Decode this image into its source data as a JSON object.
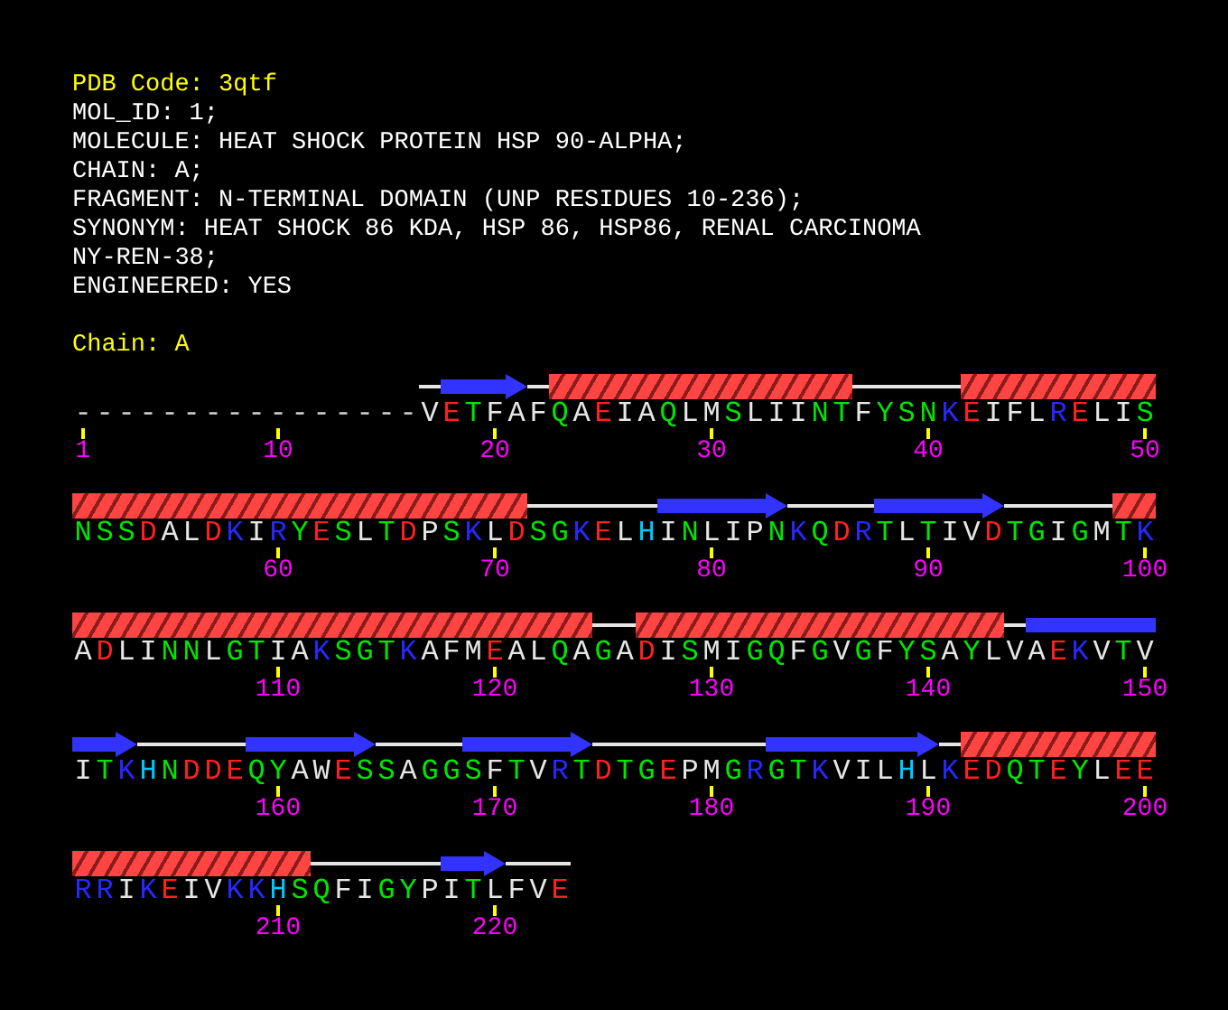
{
  "pdb_code_line": "PDB Code: 3qtf",
  "header_lines": [
    "MOL_ID: 1;",
    "MOLECULE: HEAT SHOCK PROTEIN HSP 90-ALPHA;",
    "CHAIN: A;",
    "FRAGMENT: N-TERMINAL DOMAIN (UNP RESIDUES 10-236);",
    "SYNONYM: HEAT SHOCK 86 KDA, HSP 86, HSP86, RENAL CARCINOMA",
    "NY-REN-38;",
    "ENGINEERED: YES"
  ],
  "chain_line": "Chain: A",
  "rows": [
    {
      "residues": [
        {
          "aa": "-",
          "color": "#d0d0d0",
          "kind": "gap",
          "label": "1"
        },
        {
          "aa": "-",
          "color": "#d0d0d0",
          "kind": "gap"
        },
        {
          "aa": "-",
          "color": "#d0d0d0",
          "kind": "gap"
        },
        {
          "aa": "-",
          "color": "#d0d0d0",
          "kind": "gap"
        },
        {
          "aa": "-",
          "color": "#d0d0d0",
          "kind": "gap"
        },
        {
          "aa": "-",
          "color": "#d0d0d0",
          "kind": "gap"
        },
        {
          "aa": "-",
          "color": "#d0d0d0",
          "kind": "gap"
        },
        {
          "aa": "-",
          "color": "#d0d0d0",
          "kind": "gap"
        },
        {
          "aa": "-",
          "color": "#d0d0d0",
          "kind": "gap"
        },
        {
          "aa": "-",
          "color": "#d0d0d0",
          "kind": "gap",
          "label": "10"
        },
        {
          "aa": "-",
          "color": "#d0d0d0",
          "kind": "gap"
        },
        {
          "aa": "-",
          "color": "#d0d0d0",
          "kind": "gap"
        },
        {
          "aa": "-",
          "color": "#d0d0d0",
          "kind": "gap"
        },
        {
          "aa": "-",
          "color": "#d0d0d0",
          "kind": "gap"
        },
        {
          "aa": "-",
          "color": "#d0d0d0",
          "kind": "gap"
        },
        {
          "aa": "-",
          "color": "#d0d0d0",
          "kind": "gap"
        },
        {
          "aa": "V",
          "color": "#e6e6e6",
          "kind": "coil"
        },
        {
          "aa": "E",
          "color": "#ff2020",
          "kind": "strand"
        },
        {
          "aa": "T",
          "color": "#00e600",
          "kind": "strand"
        },
        {
          "aa": "F",
          "color": "#e6e6e6",
          "kind": "strand",
          "label": "20"
        },
        {
          "aa": "A",
          "color": "#e6e6e6",
          "kind": "strand"
        },
        {
          "aa": "F",
          "color": "#e6e6e6",
          "kind": "coil"
        },
        {
          "aa": "Q",
          "color": "#00e600",
          "kind": "helix"
        },
        {
          "aa": "A",
          "color": "#e6e6e6",
          "kind": "helix"
        },
        {
          "aa": "E",
          "color": "#ff2020",
          "kind": "helix"
        },
        {
          "aa": "I",
          "color": "#e6e6e6",
          "kind": "helix"
        },
        {
          "aa": "A",
          "color": "#e6e6e6",
          "kind": "helix"
        },
        {
          "aa": "Q",
          "color": "#00e600",
          "kind": "helix"
        },
        {
          "aa": "L",
          "color": "#e6e6e6",
          "kind": "helix"
        },
        {
          "aa": "M",
          "color": "#e6e6e6",
          "kind": "helix",
          "label": "30"
        },
        {
          "aa": "S",
          "color": "#00e600",
          "kind": "helix"
        },
        {
          "aa": "L",
          "color": "#e6e6e6",
          "kind": "helix"
        },
        {
          "aa": "I",
          "color": "#e6e6e6",
          "kind": "helix"
        },
        {
          "aa": "I",
          "color": "#e6e6e6",
          "kind": "helix"
        },
        {
          "aa": "N",
          "color": "#00e600",
          "kind": "helix"
        },
        {
          "aa": "T",
          "color": "#00e600",
          "kind": "helix"
        },
        {
          "aa": "F",
          "color": "#e6e6e6",
          "kind": "coil"
        },
        {
          "aa": "Y",
          "color": "#00e600",
          "kind": "coil"
        },
        {
          "aa": "S",
          "color": "#00e600",
          "kind": "coil"
        },
        {
          "aa": "N",
          "color": "#00e600",
          "kind": "coil",
          "label": "40"
        },
        {
          "aa": "K",
          "color": "#2828ff",
          "kind": "coil"
        },
        {
          "aa": "E",
          "color": "#ff2020",
          "kind": "helix"
        },
        {
          "aa": "I",
          "color": "#e6e6e6",
          "kind": "helix"
        },
        {
          "aa": "F",
          "color": "#e6e6e6",
          "kind": "helix"
        },
        {
          "aa": "L",
          "color": "#e6e6e6",
          "kind": "helix"
        },
        {
          "aa": "R",
          "color": "#2828ff",
          "kind": "helix"
        },
        {
          "aa": "E",
          "color": "#ff2020",
          "kind": "helix"
        },
        {
          "aa": "L",
          "color": "#e6e6e6",
          "kind": "helix"
        },
        {
          "aa": "I",
          "color": "#e6e6e6",
          "kind": "helix"
        },
        {
          "aa": "S",
          "color": "#00e600",
          "kind": "helix",
          "label": "50"
        }
      ]
    },
    {
      "residues": [
        {
          "aa": "N",
          "color": "#00e600",
          "kind": "helix"
        },
        {
          "aa": "S",
          "color": "#00e600",
          "kind": "helix"
        },
        {
          "aa": "S",
          "color": "#00e600",
          "kind": "helix"
        },
        {
          "aa": "D",
          "color": "#ff2020",
          "kind": "helix"
        },
        {
          "aa": "A",
          "color": "#e6e6e6",
          "kind": "helix"
        },
        {
          "aa": "L",
          "color": "#e6e6e6",
          "kind": "helix"
        },
        {
          "aa": "D",
          "color": "#ff2020",
          "kind": "helix"
        },
        {
          "aa": "K",
          "color": "#2828ff",
          "kind": "helix"
        },
        {
          "aa": "I",
          "color": "#e6e6e6",
          "kind": "helix"
        },
        {
          "aa": "R",
          "color": "#2828ff",
          "kind": "helix",
          "label": "60"
        },
        {
          "aa": "Y",
          "color": "#00e600",
          "kind": "helix"
        },
        {
          "aa": "E",
          "color": "#ff2020",
          "kind": "helix"
        },
        {
          "aa": "S",
          "color": "#00e600",
          "kind": "helix"
        },
        {
          "aa": "L",
          "color": "#e6e6e6",
          "kind": "helix"
        },
        {
          "aa": "T",
          "color": "#00e600",
          "kind": "helix"
        },
        {
          "aa": "D",
          "color": "#ff2020",
          "kind": "helix"
        },
        {
          "aa": "P",
          "color": "#e6e6e6",
          "kind": "helix"
        },
        {
          "aa": "S",
          "color": "#00e600",
          "kind": "helix"
        },
        {
          "aa": "K",
          "color": "#2828ff",
          "kind": "helix"
        },
        {
          "aa": "L",
          "color": "#e6e6e6",
          "kind": "helix",
          "label": "70"
        },
        {
          "aa": "D",
          "color": "#ff2020",
          "kind": "helix"
        },
        {
          "aa": "S",
          "color": "#00e600",
          "kind": "coil"
        },
        {
          "aa": "G",
          "color": "#00e600",
          "kind": "coil"
        },
        {
          "aa": "K",
          "color": "#2828ff",
          "kind": "coil"
        },
        {
          "aa": "E",
          "color": "#ff2020",
          "kind": "coil"
        },
        {
          "aa": "L",
          "color": "#e6e6e6",
          "kind": "coil"
        },
        {
          "aa": "H",
          "color": "#00c8ff",
          "kind": "coil"
        },
        {
          "aa": "I",
          "color": "#e6e6e6",
          "kind": "strand"
        },
        {
          "aa": "N",
          "color": "#00e600",
          "kind": "strand"
        },
        {
          "aa": "L",
          "color": "#e6e6e6",
          "kind": "strand",
          "label": "80"
        },
        {
          "aa": "I",
          "color": "#e6e6e6",
          "kind": "strand"
        },
        {
          "aa": "P",
          "color": "#e6e6e6",
          "kind": "strand"
        },
        {
          "aa": "N",
          "color": "#00e600",
          "kind": "strand"
        },
        {
          "aa": "K",
          "color": "#2828ff",
          "kind": "coil"
        },
        {
          "aa": "Q",
          "color": "#00e600",
          "kind": "coil"
        },
        {
          "aa": "D",
          "color": "#ff2020",
          "kind": "coil"
        },
        {
          "aa": "R",
          "color": "#2828ff",
          "kind": "coil"
        },
        {
          "aa": "T",
          "color": "#00e600",
          "kind": "strand"
        },
        {
          "aa": "L",
          "color": "#e6e6e6",
          "kind": "strand"
        },
        {
          "aa": "T",
          "color": "#00e600",
          "kind": "strand",
          "label": "90"
        },
        {
          "aa": "I",
          "color": "#e6e6e6",
          "kind": "strand"
        },
        {
          "aa": "V",
          "color": "#e6e6e6",
          "kind": "strand"
        },
        {
          "aa": "D",
          "color": "#ff2020",
          "kind": "strand"
        },
        {
          "aa": "T",
          "color": "#00e600",
          "kind": "coil"
        },
        {
          "aa": "G",
          "color": "#00e600",
          "kind": "coil"
        },
        {
          "aa": "I",
          "color": "#e6e6e6",
          "kind": "coil"
        },
        {
          "aa": "G",
          "color": "#00e600",
          "kind": "coil"
        },
        {
          "aa": "M",
          "color": "#e6e6e6",
          "kind": "coil"
        },
        {
          "aa": "T",
          "color": "#00e600",
          "kind": "helix"
        },
        {
          "aa": "K",
          "color": "#2828ff",
          "kind": "helix",
          "label": "100"
        }
      ]
    },
    {
      "residues": [
        {
          "aa": "A",
          "color": "#e6e6e6",
          "kind": "helix"
        },
        {
          "aa": "D",
          "color": "#ff2020",
          "kind": "helix"
        },
        {
          "aa": "L",
          "color": "#e6e6e6",
          "kind": "helix"
        },
        {
          "aa": "I",
          "color": "#e6e6e6",
          "kind": "helix"
        },
        {
          "aa": "N",
          "color": "#00e600",
          "kind": "helix"
        },
        {
          "aa": "N",
          "color": "#00e600",
          "kind": "helix"
        },
        {
          "aa": "L",
          "color": "#e6e6e6",
          "kind": "helix"
        },
        {
          "aa": "G",
          "color": "#00e600",
          "kind": "helix"
        },
        {
          "aa": "T",
          "color": "#00e600",
          "kind": "helix"
        },
        {
          "aa": "I",
          "color": "#e6e6e6",
          "kind": "helix",
          "label": "110"
        },
        {
          "aa": "A",
          "color": "#e6e6e6",
          "kind": "helix"
        },
        {
          "aa": "K",
          "color": "#2828ff",
          "kind": "helix"
        },
        {
          "aa": "S",
          "color": "#00e600",
          "kind": "helix"
        },
        {
          "aa": "G",
          "color": "#00e600",
          "kind": "helix"
        },
        {
          "aa": "T",
          "color": "#00e600",
          "kind": "helix"
        },
        {
          "aa": "K",
          "color": "#2828ff",
          "kind": "helix"
        },
        {
          "aa": "A",
          "color": "#e6e6e6",
          "kind": "helix"
        },
        {
          "aa": "F",
          "color": "#e6e6e6",
          "kind": "helix"
        },
        {
          "aa": "M",
          "color": "#e6e6e6",
          "kind": "helix"
        },
        {
          "aa": "E",
          "color": "#ff2020",
          "kind": "helix",
          "label": "120"
        },
        {
          "aa": "A",
          "color": "#e6e6e6",
          "kind": "helix"
        },
        {
          "aa": "L",
          "color": "#e6e6e6",
          "kind": "helix"
        },
        {
          "aa": "Q",
          "color": "#00e600",
          "kind": "helix"
        },
        {
          "aa": "A",
          "color": "#e6e6e6",
          "kind": "helix"
        },
        {
          "aa": "G",
          "color": "#00e600",
          "kind": "coil"
        },
        {
          "aa": "A",
          "color": "#e6e6e6",
          "kind": "coil"
        },
        {
          "aa": "D",
          "color": "#ff2020",
          "kind": "helix"
        },
        {
          "aa": "I",
          "color": "#e6e6e6",
          "kind": "helix"
        },
        {
          "aa": "S",
          "color": "#00e600",
          "kind": "helix"
        },
        {
          "aa": "M",
          "color": "#e6e6e6",
          "kind": "helix",
          "label": "130"
        },
        {
          "aa": "I",
          "color": "#e6e6e6",
          "kind": "helix"
        },
        {
          "aa": "G",
          "color": "#00e600",
          "kind": "helix"
        },
        {
          "aa": "Q",
          "color": "#00e600",
          "kind": "helix"
        },
        {
          "aa": "F",
          "color": "#e6e6e6",
          "kind": "helix"
        },
        {
          "aa": "G",
          "color": "#00e600",
          "kind": "helix"
        },
        {
          "aa": "V",
          "color": "#e6e6e6",
          "kind": "helix"
        },
        {
          "aa": "G",
          "color": "#00e600",
          "kind": "helix"
        },
        {
          "aa": "F",
          "color": "#e6e6e6",
          "kind": "helix"
        },
        {
          "aa": "Y",
          "color": "#00e600",
          "kind": "helix"
        },
        {
          "aa": "S",
          "color": "#00e600",
          "kind": "helix",
          "label": "140"
        },
        {
          "aa": "A",
          "color": "#e6e6e6",
          "kind": "helix"
        },
        {
          "aa": "Y",
          "color": "#00e600",
          "kind": "helix"
        },
        {
          "aa": "L",
          "color": "#e6e6e6",
          "kind": "helix"
        },
        {
          "aa": "V",
          "color": "#e6e6e6",
          "kind": "coil"
        },
        {
          "aa": "A",
          "color": "#e6e6e6",
          "kind": "strand"
        },
        {
          "aa": "E",
          "color": "#ff2020",
          "kind": "strand"
        },
        {
          "aa": "K",
          "color": "#2828ff",
          "kind": "strand"
        },
        {
          "aa": "V",
          "color": "#e6e6e6",
          "kind": "strand"
        },
        {
          "aa": "T",
          "color": "#00e600",
          "kind": "strand"
        },
        {
          "aa": "V",
          "color": "#e6e6e6",
          "kind": "strand",
          "label": "150"
        }
      ]
    },
    {
      "residues": [
        {
          "aa": "I",
          "color": "#e6e6e6",
          "kind": "strand"
        },
        {
          "aa": "T",
          "color": "#00e600",
          "kind": "strand"
        },
        {
          "aa": "K",
          "color": "#2828ff",
          "kind": "strand"
        },
        {
          "aa": "H",
          "color": "#00c8ff",
          "kind": "coil"
        },
        {
          "aa": "N",
          "color": "#00e600",
          "kind": "coil"
        },
        {
          "aa": "D",
          "color": "#ff2020",
          "kind": "coil"
        },
        {
          "aa": "D",
          "color": "#ff2020",
          "kind": "coil"
        },
        {
          "aa": "E",
          "color": "#ff2020",
          "kind": "coil"
        },
        {
          "aa": "Q",
          "color": "#00e600",
          "kind": "strand"
        },
        {
          "aa": "Y",
          "color": "#00e600",
          "kind": "strand",
          "label": "160"
        },
        {
          "aa": "A",
          "color": "#e6e6e6",
          "kind": "strand"
        },
        {
          "aa": "W",
          "color": "#e6e6e6",
          "kind": "strand"
        },
        {
          "aa": "E",
          "color": "#ff2020",
          "kind": "strand"
        },
        {
          "aa": "S",
          "color": "#00e600",
          "kind": "strand"
        },
        {
          "aa": "S",
          "color": "#00e600",
          "kind": "coil"
        },
        {
          "aa": "A",
          "color": "#e6e6e6",
          "kind": "coil"
        },
        {
          "aa": "G",
          "color": "#00e600",
          "kind": "coil"
        },
        {
          "aa": "G",
          "color": "#00e600",
          "kind": "coil"
        },
        {
          "aa": "S",
          "color": "#00e600",
          "kind": "strand"
        },
        {
          "aa": "F",
          "color": "#e6e6e6",
          "kind": "strand",
          "label": "170"
        },
        {
          "aa": "T",
          "color": "#00e600",
          "kind": "strand"
        },
        {
          "aa": "V",
          "color": "#e6e6e6",
          "kind": "strand"
        },
        {
          "aa": "R",
          "color": "#2828ff",
          "kind": "strand"
        },
        {
          "aa": "T",
          "color": "#00e600",
          "kind": "strand"
        },
        {
          "aa": "D",
          "color": "#ff2020",
          "kind": "coil"
        },
        {
          "aa": "T",
          "color": "#00e600",
          "kind": "coil"
        },
        {
          "aa": "G",
          "color": "#00e600",
          "kind": "coil"
        },
        {
          "aa": "E",
          "color": "#ff2020",
          "kind": "coil"
        },
        {
          "aa": "P",
          "color": "#e6e6e6",
          "kind": "coil"
        },
        {
          "aa": "M",
          "color": "#e6e6e6",
          "kind": "coil",
          "label": "180"
        },
        {
          "aa": "G",
          "color": "#00e600",
          "kind": "coil"
        },
        {
          "aa": "R",
          "color": "#2828ff",
          "kind": "coil"
        },
        {
          "aa": "G",
          "color": "#00e600",
          "kind": "strand"
        },
        {
          "aa": "T",
          "color": "#00e600",
          "kind": "strand"
        },
        {
          "aa": "K",
          "color": "#2828ff",
          "kind": "strand"
        },
        {
          "aa": "V",
          "color": "#e6e6e6",
          "kind": "strand"
        },
        {
          "aa": "I",
          "color": "#e6e6e6",
          "kind": "strand"
        },
        {
          "aa": "L",
          "color": "#e6e6e6",
          "kind": "strand"
        },
        {
          "aa": "H",
          "color": "#00c8ff",
          "kind": "strand"
        },
        {
          "aa": "L",
          "color": "#e6e6e6",
          "kind": "strand",
          "label": "190"
        },
        {
          "aa": "K",
          "color": "#2828ff",
          "kind": "coil"
        },
        {
          "aa": "E",
          "color": "#ff2020",
          "kind": "helix"
        },
        {
          "aa": "D",
          "color": "#ff2020",
          "kind": "helix"
        },
        {
          "aa": "Q",
          "color": "#00e600",
          "kind": "helix"
        },
        {
          "aa": "T",
          "color": "#00e600",
          "kind": "helix"
        },
        {
          "aa": "E",
          "color": "#ff2020",
          "kind": "helix"
        },
        {
          "aa": "Y",
          "color": "#00e600",
          "kind": "helix"
        },
        {
          "aa": "L",
          "color": "#e6e6e6",
          "kind": "helix"
        },
        {
          "aa": "E",
          "color": "#ff2020",
          "kind": "helix"
        },
        {
          "aa": "E",
          "color": "#ff2020",
          "kind": "helix",
          "label": "200"
        }
      ]
    },
    {
      "residues": [
        {
          "aa": "R",
          "color": "#2828ff",
          "kind": "helix"
        },
        {
          "aa": "R",
          "color": "#2828ff",
          "kind": "helix"
        },
        {
          "aa": "I",
          "color": "#e6e6e6",
          "kind": "helix"
        },
        {
          "aa": "K",
          "color": "#2828ff",
          "kind": "helix"
        },
        {
          "aa": "E",
          "color": "#ff2020",
          "kind": "helix"
        },
        {
          "aa": "I",
          "color": "#e6e6e6",
          "kind": "helix"
        },
        {
          "aa": "V",
          "color": "#e6e6e6",
          "kind": "helix"
        },
        {
          "aa": "K",
          "color": "#2828ff",
          "kind": "helix"
        },
        {
          "aa": "K",
          "color": "#2828ff",
          "kind": "helix"
        },
        {
          "aa": "H",
          "color": "#00c8ff",
          "kind": "helix",
          "label": "210"
        },
        {
          "aa": "S",
          "color": "#00e600",
          "kind": "helix"
        },
        {
          "aa": "Q",
          "color": "#00e600",
          "kind": "coil"
        },
        {
          "aa": "F",
          "color": "#e6e6e6",
          "kind": "coil"
        },
        {
          "aa": "I",
          "color": "#e6e6e6",
          "kind": "coil"
        },
        {
          "aa": "G",
          "color": "#00e600",
          "kind": "coil"
        },
        {
          "aa": "Y",
          "color": "#00e600",
          "kind": "coil"
        },
        {
          "aa": "P",
          "color": "#e6e6e6",
          "kind": "coil"
        },
        {
          "aa": "I",
          "color": "#e6e6e6",
          "kind": "strand"
        },
        {
          "aa": "T",
          "color": "#00e600",
          "kind": "strand"
        },
        {
          "aa": "L",
          "color": "#e6e6e6",
          "kind": "strand",
          "label": "220"
        },
        {
          "aa": "F",
          "color": "#e6e6e6",
          "kind": "coil"
        },
        {
          "aa": "V",
          "color": "#e6e6e6",
          "kind": "coil"
        },
        {
          "aa": "E",
          "color": "#ff2020",
          "kind": "coil"
        }
      ]
    }
  ]
}
